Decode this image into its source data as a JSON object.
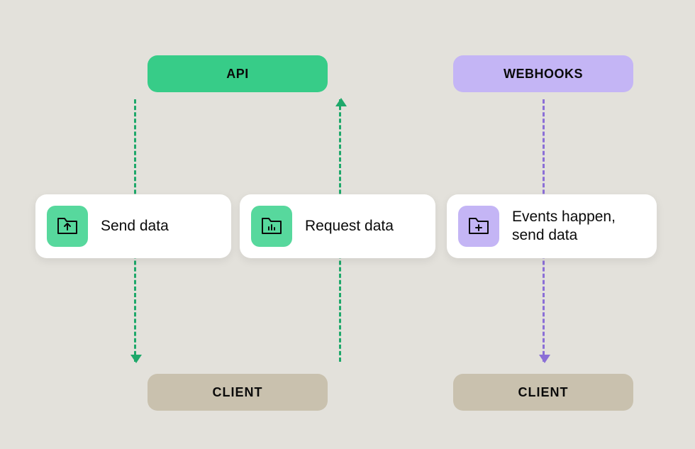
{
  "header": {
    "api_label": "API",
    "webhooks_label": "WEBHOOKS"
  },
  "cards": {
    "send": {
      "label": "Send data",
      "icon": "folder-upload-icon"
    },
    "request": {
      "label": "Request data",
      "icon": "folder-chart-icon"
    },
    "events": {
      "label": "Events happen, send data",
      "icon": "folder-add-icon"
    }
  },
  "footer": {
    "client_api_label": "CLIENT",
    "client_webhooks_label": "CLIENT"
  },
  "colors": {
    "green": "#37cc88",
    "green_dark": "#1ea86a",
    "purple": "#c4b5f5",
    "purple_dark": "#8b6fd6",
    "tan": "#c9c1ae",
    "bg": "#e3e1db"
  }
}
